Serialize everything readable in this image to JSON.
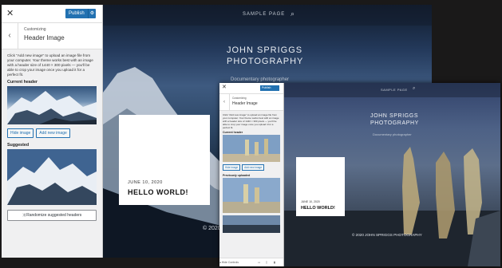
{
  "big": {
    "sidebar": {
      "close_icon": "✕",
      "publish_label": "Publish",
      "gear_icon": "⚙",
      "back_icon": "‹",
      "breadcrumb": "Customizing",
      "section_title": "Header Image",
      "description": "Click \"Add new image\" to upload an image file from your computer. Your theme works best with an image with a header size of 1440 × 300 pixels — you'll be able to crop your image once you upload it for a perfect fit.",
      "current_label": "Current header",
      "hide_label": "Hide image",
      "add_label": "Add new image",
      "suggested_label": "Suggested",
      "randomize_label": "Randomize suggested headers"
    },
    "preview": {
      "nav_item": "SAMPLE PAGE",
      "search_icon": "⌕",
      "site_title": "JOHN SPRIGGS PHOTOGRAPHY",
      "tagline": "Documentary photographer",
      "post_date": "JUNE 10, 2020",
      "post_title": "HELLO WORLD!",
      "footer": "© 2020"
    }
  },
  "small": {
    "sidebar": {
      "close_icon": "✕",
      "publish_label": "Publish",
      "back_icon": "‹",
      "breadcrumb": "Customizing",
      "section_title": "Header Image",
      "description": "Click \"Add new image\" to upload an image file from your computer. Your theme works best with an image with a header size of 1440 × 300 pixels — you'll be able to crop your image once you upload it for a perfect fit.",
      "current_label": "Current header",
      "hide_label": "Hide image",
      "add_label": "Add new image",
      "previously_label": "Previously uploaded",
      "hide_controls_label": "Hide Controls"
    },
    "preview": {
      "nav_item": "SAMPLE PAGE",
      "search_icon": "⌕",
      "site_title": "JOHN SPRIGGS PHOTOGRAPHY",
      "tagline": "Documentary photographer",
      "post_date": "JUNE 10, 2020",
      "post_title": "HELLO WORLD!",
      "footer": "© 2020 JOHN SPRIGGS PHOTOGRAPHY"
    }
  },
  "colors": {
    "wp_blue": "#2271b1",
    "background": "#1a1919"
  }
}
